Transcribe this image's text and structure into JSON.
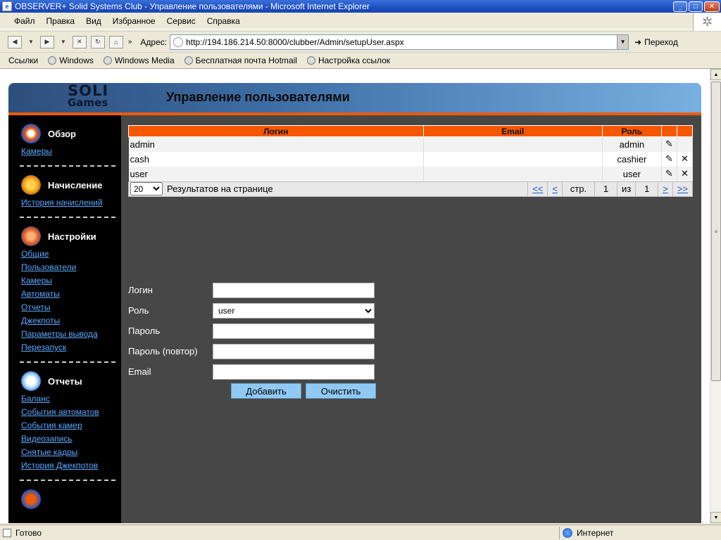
{
  "window": {
    "title": "OBSERVER+ Solid Systems Club - Управление пользователями - Microsoft Internet Explorer"
  },
  "menu": [
    "Файл",
    "Правка",
    "Вид",
    "Избранное",
    "Сервис",
    "Справка"
  ],
  "address": {
    "label": "Адрес:",
    "url": "http://194.186.214.50:8000/clubber/Admin/setupUser.aspx",
    "go_label": "Переход"
  },
  "links": {
    "label": "Ссылки",
    "items": [
      "Windows",
      "Windows Media",
      "Бесплатная почта Hotmail",
      "Настройка ссылок"
    ]
  },
  "header": {
    "logo_line1": "SOLI",
    "logo_line2": "Games",
    "title": "Управление пользователями"
  },
  "sidebar": {
    "sections": [
      {
        "title": "Обзор",
        "icon": "eye-icon",
        "links": [
          "Камеры"
        ]
      },
      {
        "title": "Начисление",
        "icon": "coins-icon",
        "links": [
          "История начислений"
        ]
      },
      {
        "title": "Настройки",
        "icon": "gears-icon",
        "links": [
          "Общие",
          "Пользователи",
          "Камеры",
          "Автоматы",
          "Отчеты",
          "Джекпоты",
          "Параметры вывода",
          "Перезапуск"
        ]
      },
      {
        "title": "Отчеты",
        "icon": "report-icon",
        "links": [
          "Баланс",
          "События автоматов",
          "События камер",
          "Видеозапись",
          "Снятые кадры",
          "История Джекпотов"
        ]
      }
    ]
  },
  "table": {
    "columns": [
      "Логин",
      "Email",
      "Роль"
    ],
    "rows": [
      {
        "login": "admin",
        "email": "",
        "role": "admin",
        "deletable": false
      },
      {
        "login": "cash",
        "email": "",
        "role": "cashier",
        "deletable": true
      },
      {
        "login": "user",
        "email": "",
        "role": "user",
        "deletable": true
      }
    ]
  },
  "pager": {
    "page_size": "20",
    "page_size_label": "Результатов на странице",
    "first": "<<",
    "prev": "<",
    "page_label": "стр.",
    "current": "1",
    "of_label": "из",
    "total": "1",
    "next": ">",
    "last": ">>"
  },
  "form": {
    "login_label": "Логин",
    "role_label": "Роль",
    "role_value": "user",
    "password_label": "Пароль",
    "password_repeat_label": "Пароль (повтор)",
    "email_label": "Email",
    "add_button": "Добавить",
    "clear_button": "Очистить"
  },
  "status": {
    "left": "Готово",
    "zone": "Интернет"
  },
  "colors": {
    "accent_orange": "#f65700",
    "link_blue": "#5aa9ff",
    "button_blue": "#8fcaf4"
  }
}
